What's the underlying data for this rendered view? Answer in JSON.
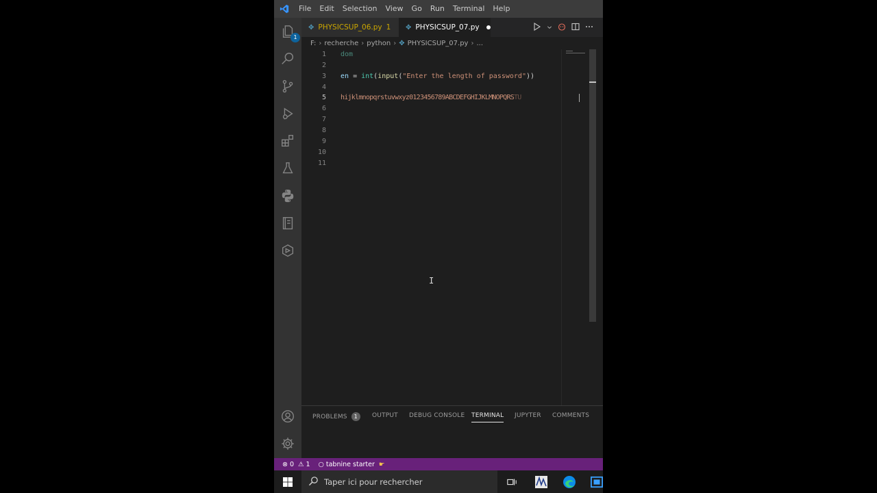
{
  "menu": [
    "File",
    "Edit",
    "Selection",
    "View",
    "Go",
    "Run",
    "Terminal",
    "Help"
  ],
  "tabs": [
    {
      "label": "PHYSICSUP_06.py",
      "problems": "1"
    },
    {
      "label": "PHYSICSUP_07.py"
    }
  ],
  "breadcrumb": [
    "F:",
    "recherche",
    "python",
    "PHYSICSUP_07.py",
    "..."
  ],
  "editor": {
    "line_numbers": [
      "1",
      "2",
      "3",
      "4",
      "5",
      "6",
      "7",
      "8",
      "9",
      "10",
      "11"
    ],
    "line1": "dom",
    "line3": {
      "var": "en",
      "op": " = ",
      "fn1": "int",
      "p1": "(",
      "fn2": "input",
      "p2": "(",
      "str": "\"Enter the length of password\"",
      "p3": "))"
    },
    "line5": "hijklmnopqrstuvwxyz0123456789ABCDEFGHIJKLMNOPQRS",
    "line5_faded": "TU"
  },
  "activity_badge": "1",
  "panel": {
    "tabs": [
      "PROBLEMS",
      "OUTPUT",
      "DEBUG CONSOLE",
      "TERMINAL",
      "JUPYTER",
      "COMMENTS"
    ],
    "problems_count": "1",
    "active_tab": "TERMINAL"
  },
  "statusbar": {
    "errors": "0",
    "warnings": "1",
    "tabnine": "tabnine starter"
  },
  "taskbar": {
    "search_placeholder": "Taper ici pour rechercher"
  },
  "colors": {
    "status_bar": "#68217a",
    "accent": "#3794ff"
  }
}
